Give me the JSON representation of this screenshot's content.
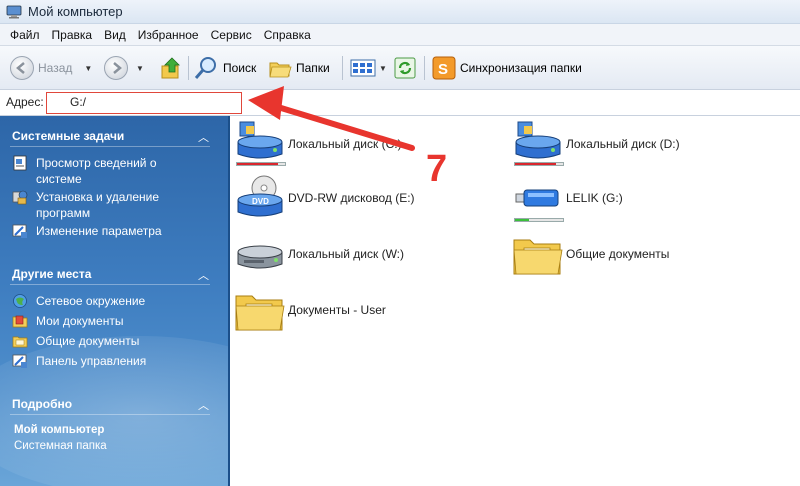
{
  "window": {
    "title": "Мой компьютер"
  },
  "menu": [
    "Файл",
    "Правка",
    "Вид",
    "Избранное",
    "Сервис",
    "Справка"
  ],
  "toolbar": {
    "back_label": "Назад",
    "search_label": "Поиск",
    "folders_label": "Папки",
    "sync_label": "Синхронизация папки"
  },
  "address": {
    "label": "Адрес:",
    "value": "G:/"
  },
  "sidebar": {
    "system_tasks": {
      "title": "Системные задачи",
      "items": [
        "Просмотр сведений о системе",
        "Установка и удаление программ",
        "Изменение параметра"
      ]
    },
    "other_places": {
      "title": "Другие места",
      "items": [
        "Сетевое окружение",
        "Мои документы",
        "Общие документы",
        "Панель управления"
      ]
    },
    "details": {
      "title": "Подробно",
      "name": "Мой компьютер",
      "type": "Системная папка"
    }
  },
  "items": [
    {
      "label": "Локальный диск (C:)",
      "kind": "hdd",
      "usage": 0.85,
      "usage_color": "#d9272e"
    },
    {
      "label": "Локальный диск (D:)",
      "kind": "hdd",
      "usage": 0.85,
      "usage_color": "#d9272e"
    },
    {
      "label": "DVD-RW дисковод (E:)",
      "kind": "dvd"
    },
    {
      "label": "LELIK (G:)",
      "kind": "usb",
      "usage": 0.3,
      "usage_color": "#3bbf3b"
    },
    {
      "label": "Локальный диск (W:)",
      "kind": "disk-gray"
    },
    {
      "label": "Общие документы",
      "kind": "folder"
    },
    {
      "label": "Документы - User",
      "kind": "folder"
    }
  ],
  "annotation": {
    "number": "7",
    "color": "#e8352e"
  }
}
